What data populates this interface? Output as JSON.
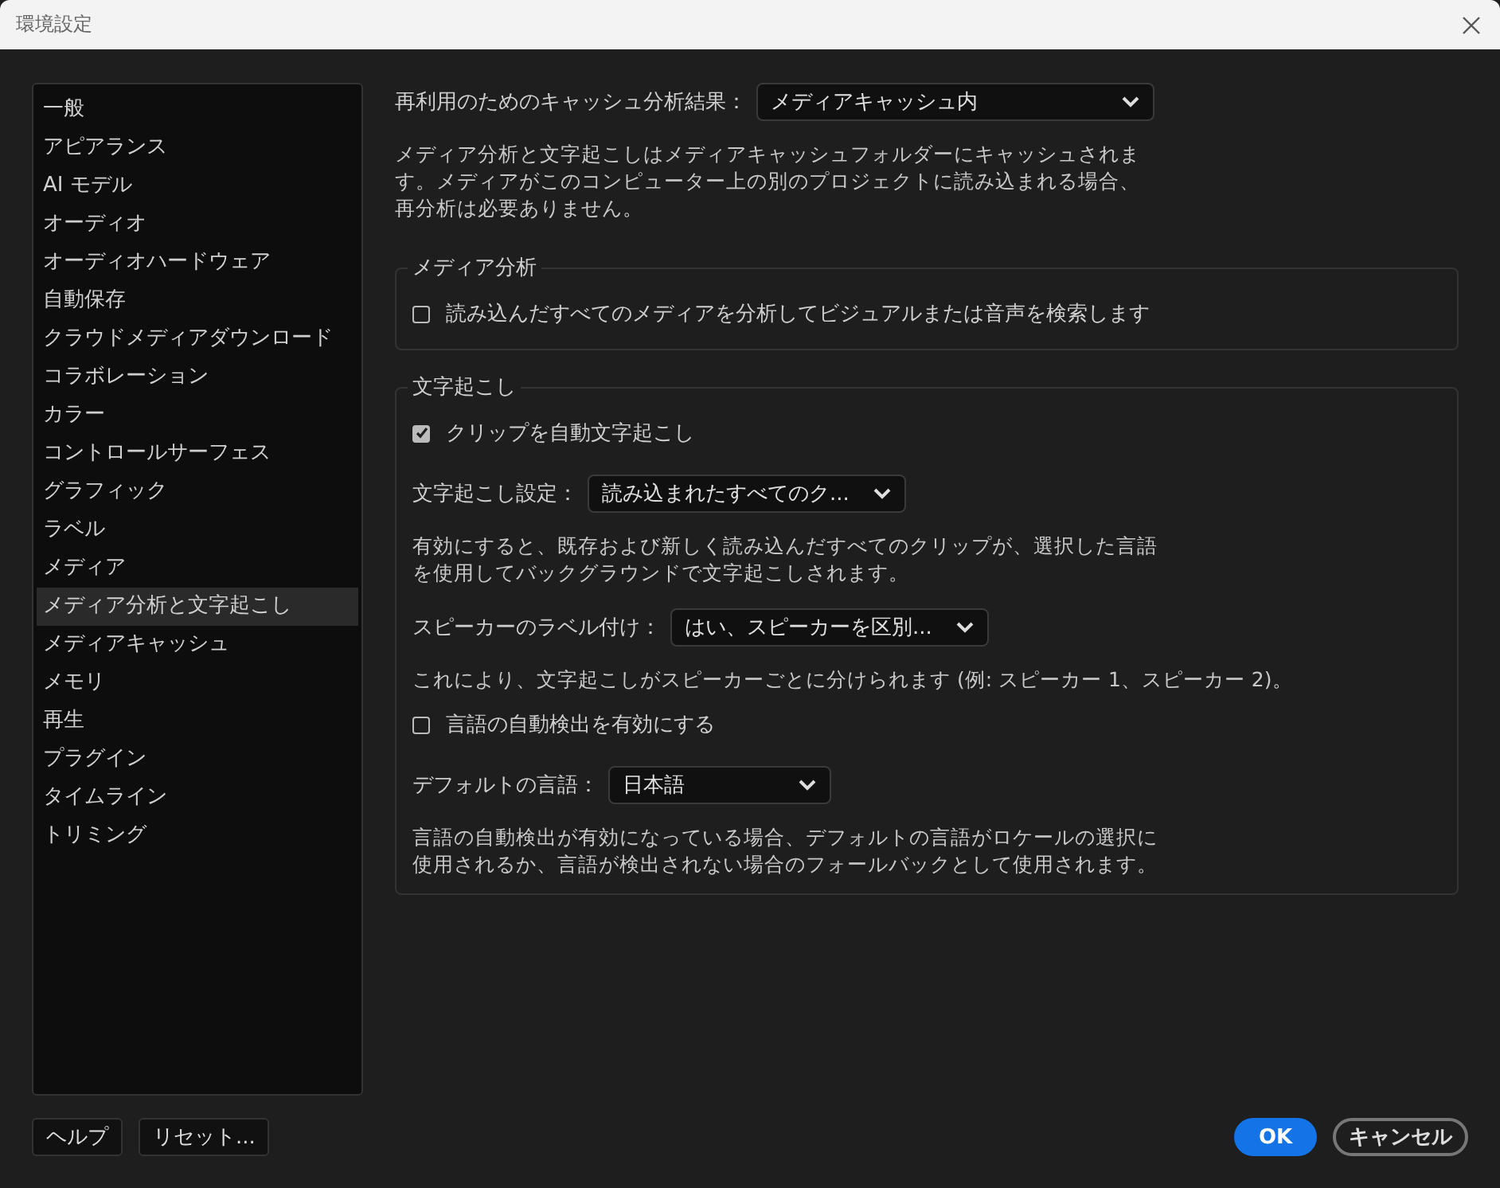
{
  "window": {
    "title": "環境設定"
  },
  "sidebar": {
    "items": [
      {
        "label": "一般",
        "selected": false
      },
      {
        "label": "アピアランス",
        "selected": false
      },
      {
        "label": "AI モデル",
        "selected": false
      },
      {
        "label": "オーディオ",
        "selected": false
      },
      {
        "label": "オーディオハードウェア",
        "selected": false
      },
      {
        "label": "自動保存",
        "selected": false
      },
      {
        "label": "クラウドメディアダウンロード",
        "selected": false
      },
      {
        "label": "コラボレーション",
        "selected": false
      },
      {
        "label": "カラー",
        "selected": false
      },
      {
        "label": "コントロールサーフェス",
        "selected": false
      },
      {
        "label": "グラフィック",
        "selected": false
      },
      {
        "label": "ラベル",
        "selected": false
      },
      {
        "label": "メディア",
        "selected": false
      },
      {
        "label": "メディア分析と文字起こし",
        "selected": true
      },
      {
        "label": "メディアキャッシュ",
        "selected": false
      },
      {
        "label": "メモリ",
        "selected": false
      },
      {
        "label": "再生",
        "selected": false
      },
      {
        "label": "プラグイン",
        "selected": false
      },
      {
        "label": "タイムライン",
        "selected": false
      },
      {
        "label": "トリミング",
        "selected": false
      }
    ]
  },
  "cache_setting": {
    "label": "再利用のためのキャッシュ分析結果：",
    "value": "メディアキャッシュ内"
  },
  "cache_note": [
    "メディア分析と文字起こしはメディアキャッシュフォルダーにキャッシュされま",
    "す。メディアがこのコンピューター上の別のプロジェクトに読み込まれる場合、",
    "再分析は必要ありません。"
  ],
  "sections": [
    {
      "title": "メディア分析",
      "items": [
        {
          "kind": "checkbox",
          "label": "読み込んだすべてのメディアを分析してビジュアルまたは音声を検索します",
          "checked": false
        }
      ]
    },
    {
      "title": "文字起こし",
      "items": [
        {
          "kind": "checkbox",
          "label": "クリップを自動文字起こし",
          "checked": true
        },
        {
          "kind": "select",
          "label": "文字起こし設定：",
          "value": "読み込まれたすべてのク..."
        },
        {
          "kind": "note",
          "lines": [
            "有効にすると、既存および新しく読み込んだすべてのクリップが、選択した言語",
            "を使用してバックグラウンドで文字起こしされます。"
          ]
        },
        {
          "kind": "select",
          "label": "スピーカーのラベル付け：",
          "value": "はい、スピーカーを区別..."
        },
        {
          "kind": "note",
          "lines": [
            "これにより、文字起こしがスピーカーごとに分けられます (例: スピーカー 1、スピーカー 2)。"
          ]
        },
        {
          "kind": "checkbox",
          "label": "言語の自動検出を有効にする",
          "checked": false
        },
        {
          "kind": "select",
          "label": "デフォルトの言語：",
          "value": "日本語"
        },
        {
          "kind": "note",
          "lines": [
            "言語の自動検出が有効になっている場合、デフォルトの言語がロケールの選択に",
            "使用されるか、言語が検出されない場合のフォールバックとして使用されます。"
          ]
        }
      ]
    }
  ],
  "footer": {
    "left": [
      {
        "label": "ヘルプ"
      },
      {
        "label": "リセット..."
      }
    ],
    "right": [
      {
        "label": "OK",
        "kind": "primary"
      },
      {
        "label": "キャンセル",
        "kind": "secondary"
      }
    ]
  }
}
